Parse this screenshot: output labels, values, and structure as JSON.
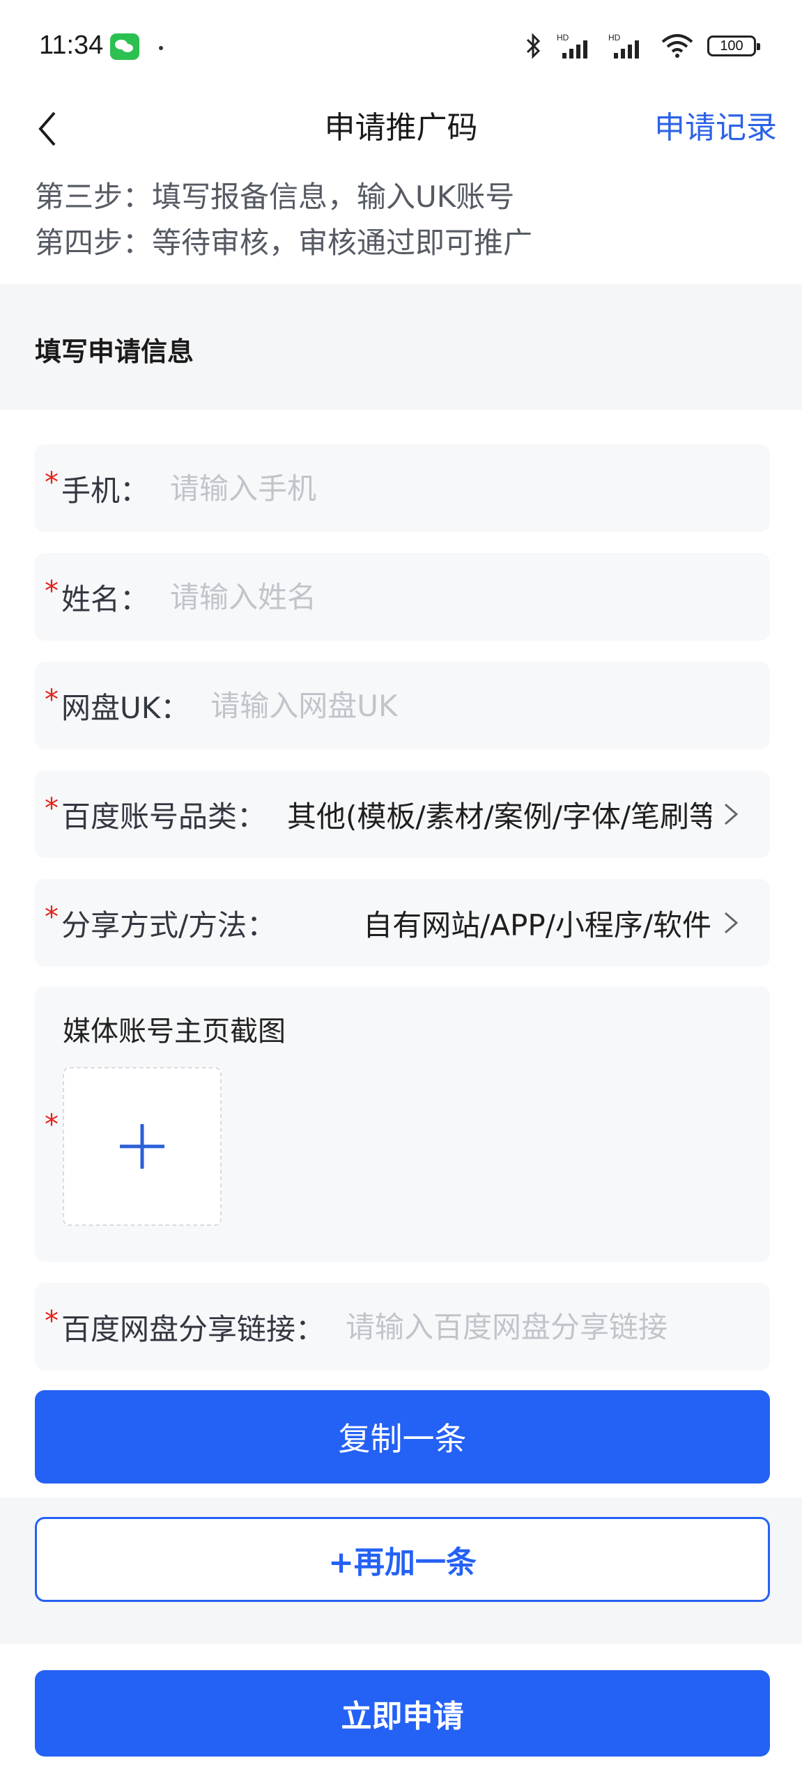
{
  "status_bar": {
    "time": "11:34",
    "battery": "100"
  },
  "nav": {
    "title": "申请推广码",
    "record_link": "申请记录"
  },
  "steps": [
    "第三步：填写报备信息，输入UK账号",
    "第四步：等待审核，审核通过即可推广"
  ],
  "section": {
    "title": "填写申请信息"
  },
  "form": {
    "phone": {
      "required": "*",
      "label": "手机：",
      "placeholder": "请输入手机"
    },
    "name": {
      "required": "*",
      "label": "姓名：",
      "placeholder": "请输入姓名"
    },
    "uk": {
      "required": "*",
      "label": "网盘UK：",
      "placeholder": "请输入网盘UK"
    },
    "category": {
      "required": "*",
      "label": "百度账号品类：",
      "value": "其他(模板/素材/案例/字体/笔刷等"
    },
    "share_method": {
      "required": "*",
      "label": "分享方式/方法：",
      "value": "自有网站/APP/小程序/软件"
    },
    "screenshot": {
      "required": "*",
      "label": "媒体账号主页截图"
    },
    "share_link": {
      "required": "*",
      "label": "百度网盘分享链接：",
      "placeholder": "请输入百度网盘分享链接"
    }
  },
  "buttons": {
    "copy": "复制一条",
    "add": "+再加一条",
    "submit": "立即申请"
  },
  "colors": {
    "accent": "#2461f5",
    "link": "#2b62e6",
    "required": "#e2231a"
  }
}
